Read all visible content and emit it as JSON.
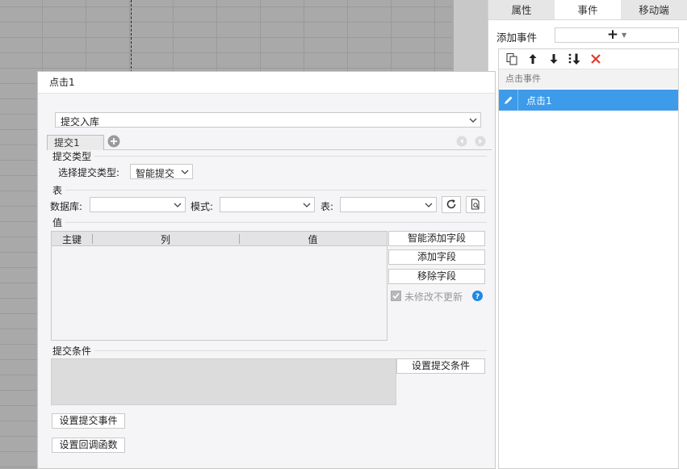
{
  "right_panel": {
    "tabs": [
      "属性",
      "事件",
      "移动端"
    ],
    "add_event_label": "添加事件",
    "add_event_plus": "+",
    "event_group": "点击事件",
    "event_item": "点击1"
  },
  "dialog": {
    "title": "点击1",
    "action_select": "提交入库",
    "tab_label": "提交1",
    "submit_type": {
      "section": "提交类型",
      "label": "选择提交类型:",
      "value": "智能提交"
    },
    "table": {
      "section": "表",
      "db_label": "数据库:",
      "db_value": "",
      "mode_label": "模式:",
      "mode_value": "",
      "table_label": "表:",
      "table_value": ""
    },
    "value": {
      "section": "值",
      "columns": [
        "主键",
        "列",
        "值"
      ],
      "btn_smart_add": "智能添加字段",
      "btn_add": "添加字段",
      "btn_remove": "移除字段",
      "checkbox_label": "未修改不更新",
      "checkbox_checked": true
    },
    "condition": {
      "section": "提交条件",
      "btn_set": "设置提交条件"
    },
    "btn_set_submit_event": "设置提交事件",
    "btn_set_callback": "设置回调函数"
  },
  "colors": {
    "accent": "#3d9be9",
    "delete_red": "#e03a2f",
    "help_blue": "#1e88e5"
  }
}
